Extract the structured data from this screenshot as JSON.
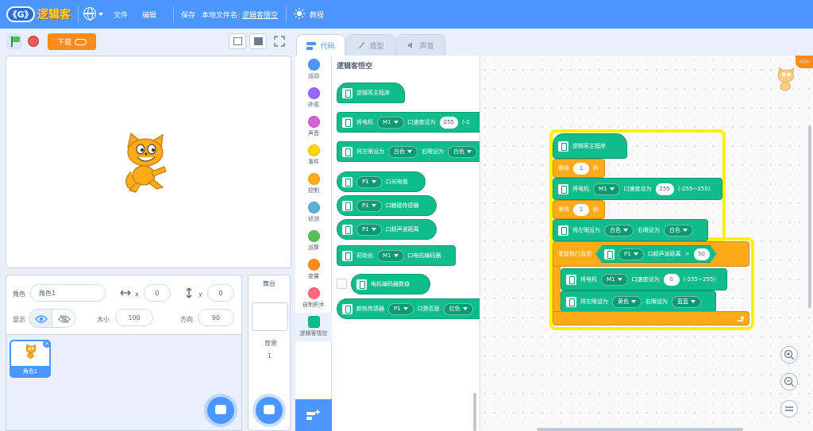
{
  "header": {
    "logo_badge": "《G》",
    "logo_text": "逻辑客",
    "menu_file": "文件",
    "menu_edit": "编辑",
    "save": "保存",
    "filename_label": "本地文件名:",
    "filename": "逻辑客悟空",
    "tutorial": "教程"
  },
  "stage_controls": {
    "download_label": "下载"
  },
  "sprite_info": {
    "sprite_label": "角色",
    "sprite_name": "角色1",
    "x_label": "x",
    "x_value": "0",
    "y_label": "y",
    "y_value": "0",
    "show_label": "显示",
    "size_label": "大小",
    "size_value": "100",
    "direction_label": "方向",
    "direction_value": "90"
  },
  "sprite_list": {
    "items": [
      {
        "name": "角色1"
      }
    ]
  },
  "stage_panel": {
    "title": "舞台",
    "backdrop_label": "背景",
    "backdrop_count": "1"
  },
  "tabs": [
    {
      "label": "代码"
    },
    {
      "label": "造型"
    },
    {
      "label": "声音"
    }
  ],
  "categories": [
    {
      "label": "运动",
      "color": "#4c97ff"
    },
    {
      "label": "外观",
      "color": "#9966ff"
    },
    {
      "label": "声音",
      "color": "#cf63cf"
    },
    {
      "label": "事件",
      "color": "#ffd500"
    },
    {
      "label": "控制",
      "color": "#ffab19"
    },
    {
      "label": "侦测",
      "color": "#5cb1d6"
    },
    {
      "label": "运算",
      "color": "#59c059"
    },
    {
      "label": "变量",
      "color": "#ff8c1a"
    },
    {
      "label": "自制积木",
      "color": "#ff6680"
    },
    {
      "label": "逻辑客悟空",
      "color": "#0fbd8c"
    }
  ],
  "palette": {
    "title": "逻辑客悟空",
    "blocks": {
      "main": "逻辑客主程序",
      "motor_prefix": "将电机",
      "motor_port": "M1",
      "motor_speed_label": "口速度设为",
      "motor_speed": "255",
      "motor_range": "(-2",
      "lights_prefix": "将左眼设为",
      "lights_left": "白色",
      "lights_right_label": "右眼设为",
      "lights_right": "白色",
      "light_port": "P1",
      "light_label": "口光电值",
      "touch_port": "P1",
      "touch_label": "口触碰传感器",
      "ultra_port": "P1",
      "ultra_label": "口超声波距离",
      "init_prefix": "初始化",
      "init_port": "M1",
      "init_label": "口电机编码器",
      "encoder_label": "电机编码器数值",
      "color_prefix": "颜色传感器",
      "color_port": "P1",
      "color_label": "口是否是",
      "color_value": "红色"
    }
  },
  "script": {
    "main": "逻辑客主程序",
    "wait_label": "等待",
    "wait_unit": "秒",
    "wait1": "1",
    "wait2": "1",
    "motor_prefix": "将电机",
    "motor_port": "M1",
    "motor_speed_label": "口速度设为",
    "motor_speed": "255",
    "motor_range": "(-255~255)",
    "lights_prefix": "将左眼设为",
    "lights_left": "白色",
    "lights_right_label": "右眼设为",
    "lights_right": "白色",
    "repeat_label": "重复执行直到",
    "cond_port": "P1",
    "cond_label": "口超声波距离",
    "cond_op": ">",
    "cond_value": "50",
    "inner_motor_prefix": "将电机",
    "inner_motor_port": "M1",
    "inner_motor_speed_label": "口速度设为",
    "inner_motor_speed": "0",
    "inner_motor_range": "(-255~255)",
    "inner_lights_prefix": "将左眼设为",
    "inner_lights_left": "黄色",
    "inner_lights_right_label": "右眼设为",
    "inner_lights_right": "蓝蓝"
  },
  "workspace": {
    "code_toggle": "</>"
  },
  "icons": {
    "green_flag": "green-flag-icon",
    "stop": "stop-icon",
    "globe": "globe-icon",
    "bulb": "lightbulb-icon",
    "eye": "eye-icon",
    "eye_off": "eye-off-icon",
    "zoom_in": "zoom-in-icon",
    "zoom_out": "zoom-out-icon",
    "zoom_reset": "zoom-reset-icon"
  }
}
